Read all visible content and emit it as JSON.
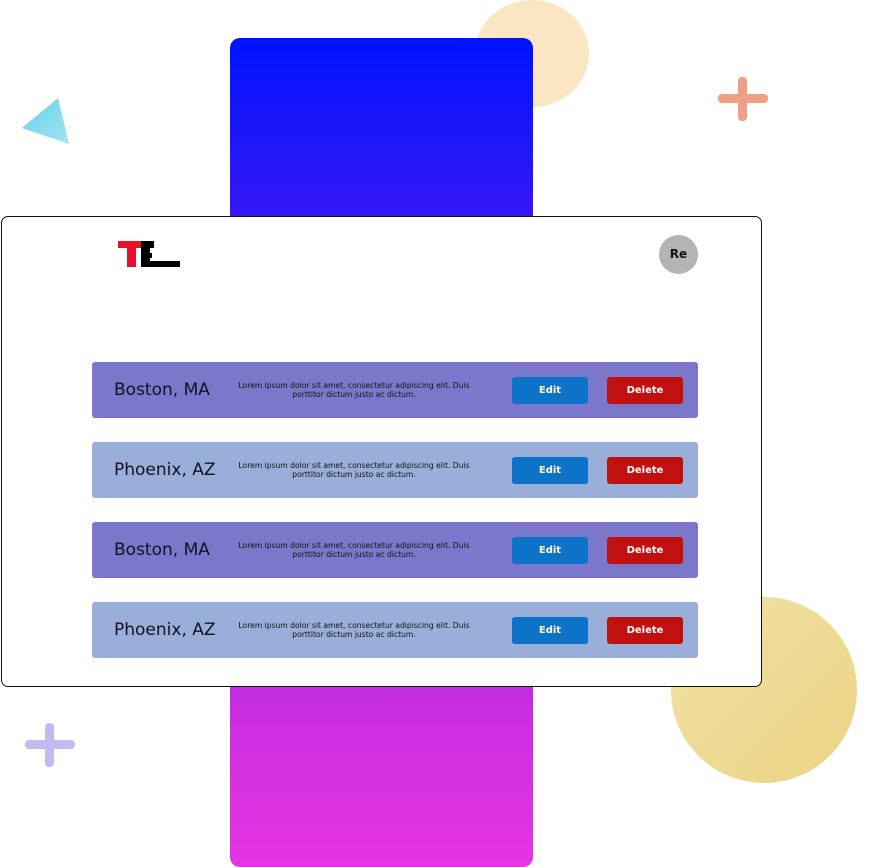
{
  "header": {
    "avatar_initials": "Re"
  },
  "colors": {
    "row_dark": "#7b78cc",
    "row_light": "#99afda",
    "edit_button": "#0d73c8",
    "delete_button": "#c0100f",
    "logo_red": "#e8112d",
    "logo_black": "#000000"
  },
  "list": {
    "items": [
      {
        "city": "Boston, MA",
        "description": "Lorem ipsum dolor sit amet, consectetur adipiscing elit. Duis porttitor dictum justo ac dictum.",
        "edit_label": "Edit",
        "delete_label": "Delete"
      },
      {
        "city": "Phoenix, AZ",
        "description": "Lorem ipsum dolor sit amet, consectetur adipiscing elit. Duis porttitor dictum justo ac dictum.",
        "edit_label": "Edit",
        "delete_label": "Delete"
      },
      {
        "city": "Boston, MA",
        "description": "Lorem ipsum dolor sit amet, consectetur adipiscing elit. Duis porttitor dictum justo ac dictum.",
        "edit_label": "Edit",
        "delete_label": "Delete"
      },
      {
        "city": "Phoenix, AZ",
        "description": "Lorem ipsum dolor sit amet, consectetur adipiscing elit. Duis porttitor dictum justo ac dictum.",
        "edit_label": "Edit",
        "delete_label": "Delete"
      }
    ]
  }
}
